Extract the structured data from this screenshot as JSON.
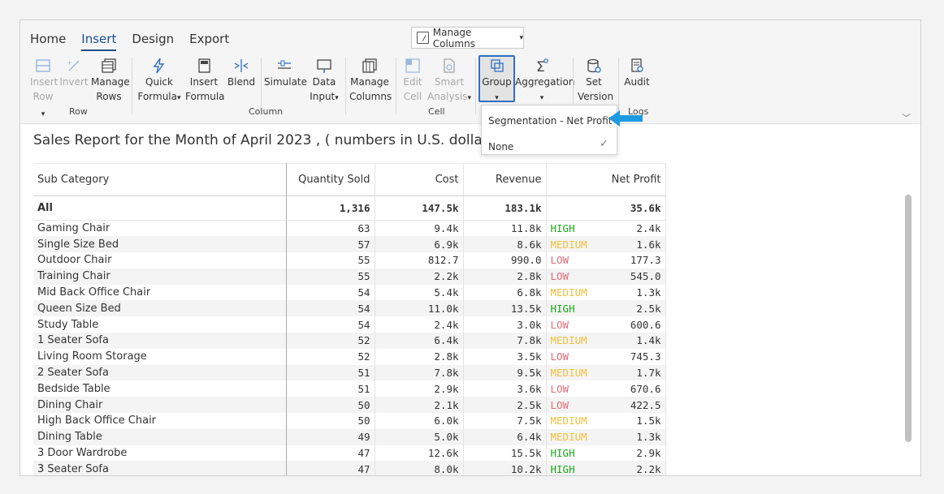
{
  "tabs": [
    "Home",
    "Insert",
    "Design",
    "Export"
  ],
  "active_tab": "Insert",
  "manage_columns_top": "Manage Columns",
  "ribbon": {
    "insert_row": [
      "Insert",
      "Row"
    ],
    "invert_row": [
      "Invert",
      "Row"
    ],
    "manage_rows": [
      "Manage",
      "Rows"
    ],
    "quick_formula": [
      "Quick",
      "Formula"
    ],
    "insert_formula": [
      "Insert",
      "Formula"
    ],
    "blend": "Blend",
    "simulate": "Simulate",
    "data_input": [
      "Data",
      "Input"
    ],
    "manage_columns": [
      "Manage",
      "Columns"
    ],
    "edit_cell": [
      "Edit",
      "Cell"
    ],
    "smart_analysis": [
      "Smart",
      "Analysis"
    ],
    "group": "Group",
    "aggregation": "Aggregation",
    "set_version": [
      "Set",
      "Version"
    ],
    "audit": "Audit",
    "groups": [
      "Row",
      "Column",
      "Cell",
      "Logs"
    ]
  },
  "dropdown": {
    "items": [
      "Segmentation - Net Profit",
      "None"
    ],
    "selected": "None"
  },
  "report_title": "Sales Report for the Month of April 2023 , ( numbers in U.S. dollars )",
  "columns": [
    "Sub Category",
    "Quantity Sold",
    "Cost",
    "Revenue",
    "Net Profit"
  ],
  "total": {
    "label": "All",
    "qty": "1,316",
    "cost": "147.5k",
    "revenue": "183.1k",
    "profit": "35.6k"
  },
  "rows": [
    {
      "name": "Gaming Chair",
      "qty": "63",
      "cost": "9.4k",
      "revenue": "11.8k",
      "seg": "HIGH",
      "profit": "2.4k"
    },
    {
      "name": "Single Size Bed",
      "qty": "57",
      "cost": "6.9k",
      "revenue": "8.6k",
      "seg": "MEDIUM",
      "profit": "1.6k"
    },
    {
      "name": "Outdoor Chair",
      "qty": "55",
      "cost": "812.7",
      "revenue": "990.0",
      "seg": "LOW",
      "profit": "177.3"
    },
    {
      "name": "Training Chair",
      "qty": "55",
      "cost": "2.2k",
      "revenue": "2.8k",
      "seg": "LOW",
      "profit": "545.0"
    },
    {
      "name": "Mid Back Office Chair",
      "qty": "54",
      "cost": "5.4k",
      "revenue": "6.8k",
      "seg": "MEDIUM",
      "profit": "1.3k"
    },
    {
      "name": "Queen Size Bed",
      "qty": "54",
      "cost": "11.0k",
      "revenue": "13.5k",
      "seg": "HIGH",
      "profit": "2.5k"
    },
    {
      "name": "Study Table",
      "qty": "54",
      "cost": "2.4k",
      "revenue": "3.0k",
      "seg": "LOW",
      "profit": "600.6"
    },
    {
      "name": "1 Seater Sofa",
      "qty": "52",
      "cost": "6.4k",
      "revenue": "7.8k",
      "seg": "MEDIUM",
      "profit": "1.4k"
    },
    {
      "name": "Living Room Storage",
      "qty": "52",
      "cost": "2.8k",
      "revenue": "3.5k",
      "seg": "LOW",
      "profit": "745.3"
    },
    {
      "name": "2 Seater Sofa",
      "qty": "51",
      "cost": "7.8k",
      "revenue": "9.5k",
      "seg": "MEDIUM",
      "profit": "1.7k"
    },
    {
      "name": "Bedside Table",
      "qty": "51",
      "cost": "2.9k",
      "revenue": "3.6k",
      "seg": "LOW",
      "profit": "670.6"
    },
    {
      "name": "Dining Chair",
      "qty": "50",
      "cost": "2.1k",
      "revenue": "2.5k",
      "seg": "LOW",
      "profit": "422.5"
    },
    {
      "name": "High Back Office Chair",
      "qty": "50",
      "cost": "6.0k",
      "revenue": "7.5k",
      "seg": "MEDIUM",
      "profit": "1.5k"
    },
    {
      "name": "Dining Table",
      "qty": "49",
      "cost": "5.0k",
      "revenue": "6.4k",
      "seg": "MEDIUM",
      "profit": "1.3k"
    },
    {
      "name": "3 Door Wardrobe",
      "qty": "47",
      "cost": "12.6k",
      "revenue": "15.5k",
      "seg": "HIGH",
      "profit": "2.9k"
    },
    {
      "name": "3 Seater Sofa",
      "qty": "47",
      "cost": "8.0k",
      "revenue": "10.2k",
      "seg": "HIGH",
      "profit": "2.2k"
    }
  ],
  "colors": {
    "accent": "#1a4f8a",
    "high": "#1aa71a",
    "medium": "#f1c03b",
    "low": "#e06d78",
    "arrow": "#1e9be0"
  }
}
